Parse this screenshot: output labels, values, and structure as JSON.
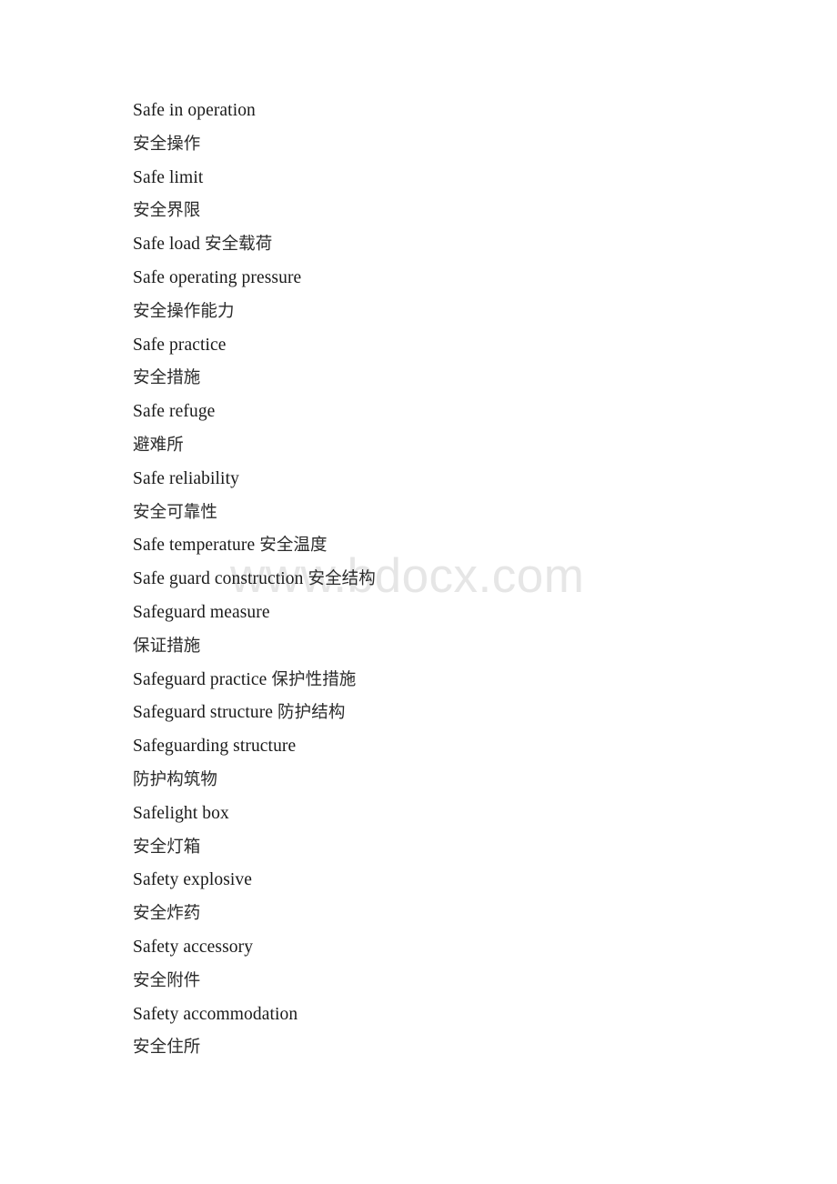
{
  "document": {
    "watermark": "www.bdocx.com",
    "watermark_color": "#e6e6e6",
    "text_color": "#1a1a1a",
    "background_color": "#ffffff",
    "lines": [
      {
        "en": "Safe in operation",
        "zh": ""
      },
      {
        "en": "",
        "zh": "安全操作"
      },
      {
        "en": "Safe limit",
        "zh": ""
      },
      {
        "en": "",
        "zh": "安全界限"
      },
      {
        "en": "Safe load",
        "zh": "安全载荷"
      },
      {
        "en": "Safe operating pressure",
        "zh": ""
      },
      {
        "en": "",
        "zh": "安全操作能力"
      },
      {
        "en": "Safe practice",
        "zh": ""
      },
      {
        "en": "",
        "zh": "安全措施"
      },
      {
        "en": "Safe refuge",
        "zh": ""
      },
      {
        "en": "",
        "zh": "避难所"
      },
      {
        "en": "Safe reliability",
        "zh": ""
      },
      {
        "en": "",
        "zh": "安全可靠性"
      },
      {
        "en": "Safe temperature",
        "zh": "安全温度"
      },
      {
        "en": "Safe guard construction",
        "zh": "安全结构"
      },
      {
        "en": "Safeguard measure",
        "zh": ""
      },
      {
        "en": "",
        "zh": "保证措施"
      },
      {
        "en": "Safeguard practice",
        "zh": "保护性措施"
      },
      {
        "en": "Safeguard structure",
        "zh": "防护结构"
      },
      {
        "en": "Safeguarding structure",
        "zh": ""
      },
      {
        "en": "",
        "zh": "防护构筑物"
      },
      {
        "en": "Safelight box",
        "zh": ""
      },
      {
        "en": "",
        "zh": "安全灯箱"
      },
      {
        "en": "Safety explosive",
        "zh": ""
      },
      {
        "en": "",
        "zh": "安全炸药"
      },
      {
        "en": "Safety accessory",
        "zh": ""
      },
      {
        "en": "",
        "zh": "安全附件"
      },
      {
        "en": "Safety accommodation",
        "zh": ""
      },
      {
        "en": "",
        "zh": "安全住所"
      }
    ]
  }
}
